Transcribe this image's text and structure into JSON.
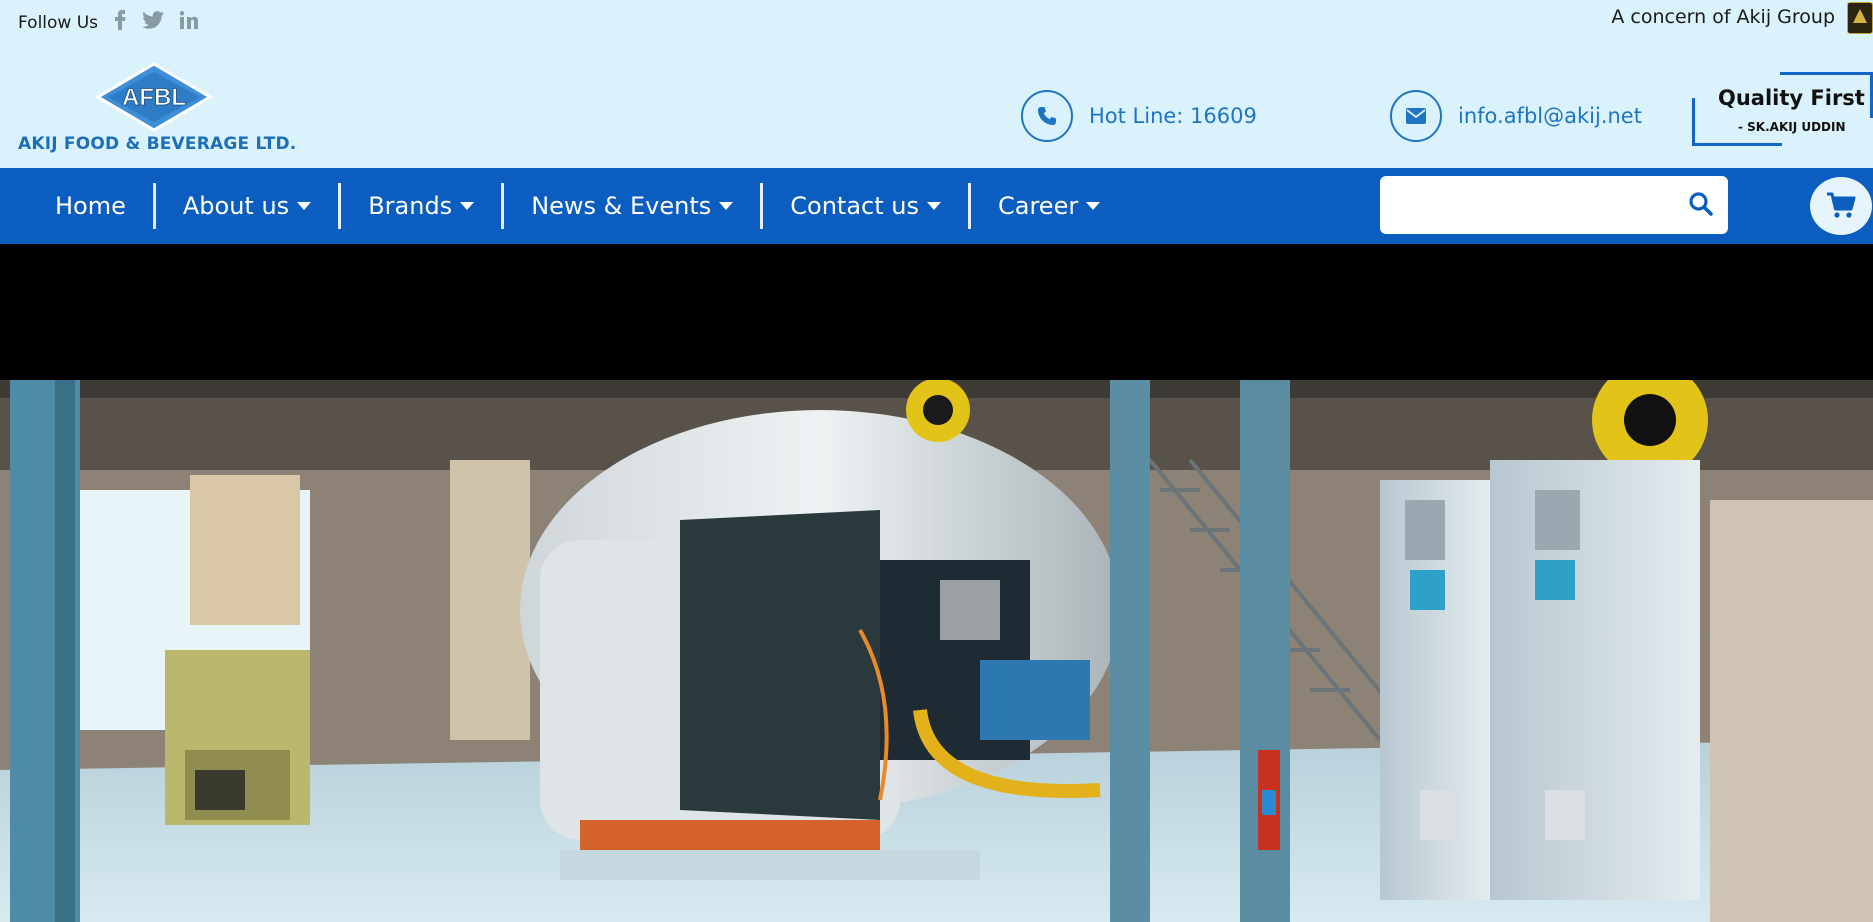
{
  "topbar": {
    "follow_label": "Follow Us",
    "social": [
      {
        "icon": "facebook-icon",
        "glyph": "f"
      },
      {
        "icon": "twitter-icon",
        "glyph": "🐦"
      },
      {
        "icon": "linkedin-icon",
        "glyph": "in"
      }
    ],
    "concern_text": "A concern of Akij Group"
  },
  "logo": {
    "mark": "AFBL",
    "company": "AKIJ FOOD & BEVERAGE LTD."
  },
  "contacts": {
    "hotline": "Hot Line: 16609",
    "email": "info.afbl@akij.net"
  },
  "quality": {
    "title": "Quality First",
    "author": "- SK.AKIJ UDDIN"
  },
  "nav": {
    "items": [
      {
        "label": "Home",
        "dropdown": false
      },
      {
        "label": "About us",
        "dropdown": true
      },
      {
        "label": "Brands",
        "dropdown": true
      },
      {
        "label": "News & Events",
        "dropdown": true
      },
      {
        "label": "Contact us",
        "dropdown": true
      },
      {
        "label": "Career",
        "dropdown": true
      }
    ],
    "search_placeholder": ""
  },
  "colors": {
    "topbar_bg": "#d9f2fb",
    "nav_bg": "#0b5ebf",
    "accent": "#1f75c4"
  }
}
